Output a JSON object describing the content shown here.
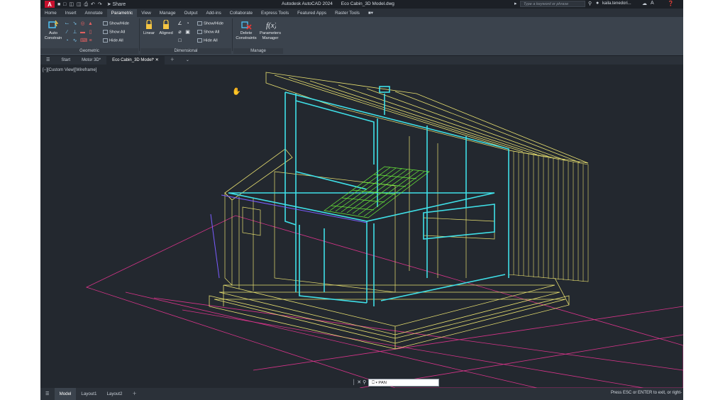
{
  "app": {
    "logo": "A",
    "title": "Autodesk AutoCAD 2024",
    "document": "Eco Cabin_3D Model.dwg",
    "share_label": "Share",
    "search_placeholder": "Type a keyword or phrase",
    "username": "kaila.tenedori..."
  },
  "ribbon_tabs": [
    "Home",
    "Insert",
    "Annotate",
    "Parametric",
    "View",
    "Manage",
    "Output",
    "Add-ins",
    "Collaborate",
    "Express Tools",
    "Featured Apps",
    "Raster Tools"
  ],
  "active_ribbon_tab": "Parametric",
  "ribbon": {
    "geometric": {
      "title": "Geometric",
      "auto_constrain": "Auto\nConstrain",
      "show_hide": "Show/Hide",
      "show_all": "Show All",
      "hide_all": "Hide All"
    },
    "dimensional": {
      "title": "Dimensional",
      "linear": "Linear",
      "aligned": "Aligned",
      "show_hide": "Show/Hide",
      "show_all": "Show All",
      "hide_all": "Hide All"
    },
    "manage": {
      "title": "Manage",
      "delete_constraints": "Delete\nConstraints",
      "parameters_manager": "Parameters\nManager"
    }
  },
  "file_tabs": [
    {
      "label": "Start",
      "active": false
    },
    {
      "label": "Motor 3D*",
      "active": false
    },
    {
      "label": "Eco Cabin_3D Model*",
      "active": true
    }
  ],
  "viewport": {
    "view_label": "[−][Custom View][Wireframe]"
  },
  "command": {
    "value": "PAN"
  },
  "layout_tabs": [
    {
      "label": "Model",
      "active": true
    },
    {
      "label": "Layout1",
      "active": false
    },
    {
      "label": "Layout2",
      "active": false
    }
  ],
  "status_message": "Press ESC or ENTER to exit, or right-",
  "colors": {
    "background": "#23282f",
    "ribbon": "#3b434d",
    "wire_cyan": "#3fe0e8",
    "wire_yellow": "#e8e070",
    "wire_green": "#6cf23a",
    "wire_magenta": "#d8348a",
    "accent_red": "#c8102e"
  }
}
